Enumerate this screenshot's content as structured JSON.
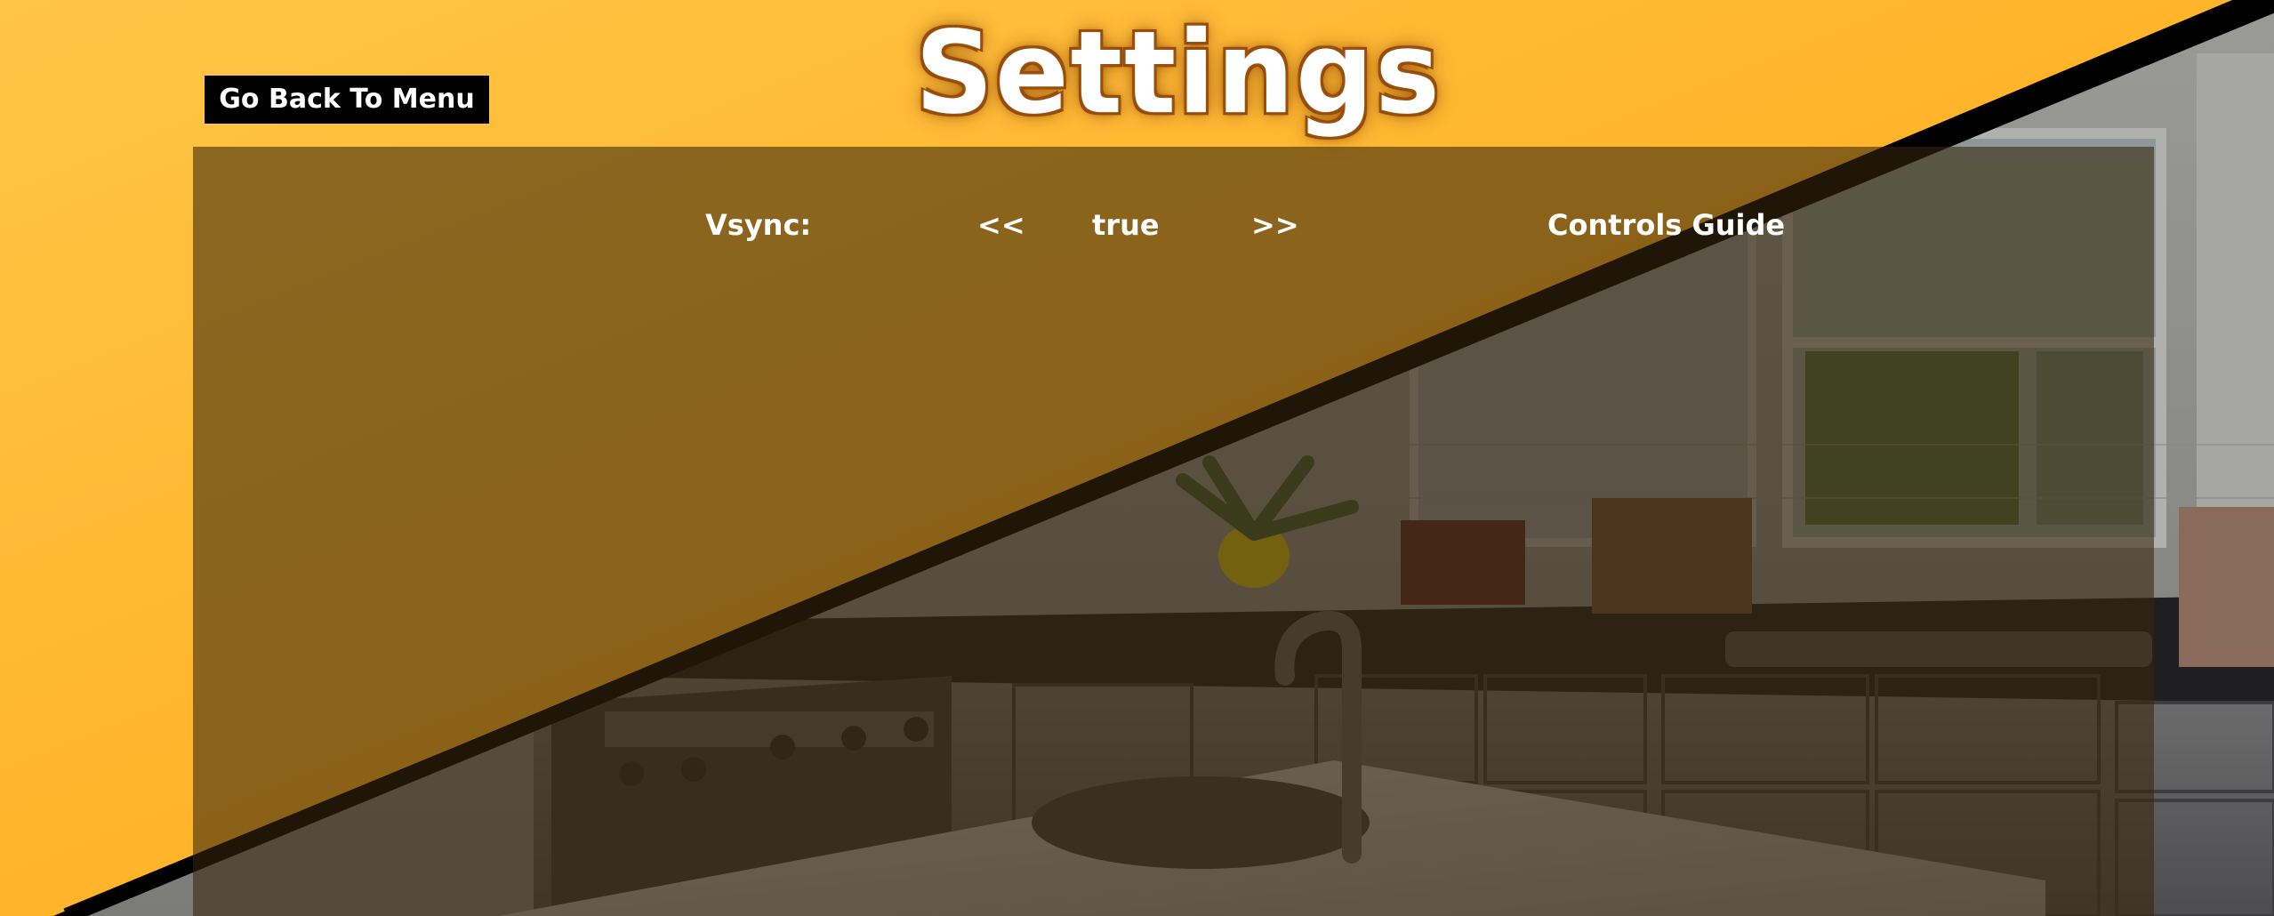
{
  "screen": {
    "title": "Settings",
    "back_button": "Go Back To Menu"
  },
  "settings": {
    "vsync": {
      "label": "Vsync:",
      "prev": "<<",
      "value": "true",
      "next": ">>"
    },
    "controls_guide": "Controls Guide"
  },
  "colors": {
    "orange_light": "#ffbe3c",
    "orange": "#ffad1d",
    "panel_overlay": "#37260c",
    "divider": "#000000",
    "title_outline": "#a4570f",
    "text": "#ffffff"
  }
}
